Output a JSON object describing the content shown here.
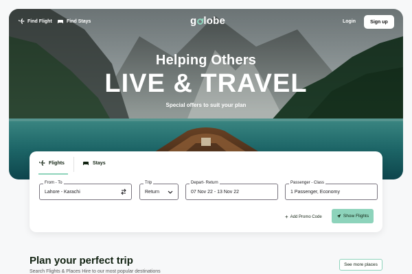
{
  "nav": {
    "find_flight": "Find Flight",
    "find_stays": "Find Stays",
    "logo_prefix": "g",
    "logo_suffix": "lobe",
    "login": "Login",
    "signup": "Sign up"
  },
  "hero": {
    "subtitle": "Helping Others",
    "title": "LIVE & TRAVEL",
    "tagline": "Special offers to suit your plan"
  },
  "search": {
    "tabs": [
      {
        "label": "Flights",
        "icon": "airplane-icon",
        "active": true
      },
      {
        "label": "Stays",
        "icon": "bed-icon",
        "active": false
      }
    ],
    "fields": {
      "from_to": {
        "label": "From - To",
        "value": "Lahore - Karachi",
        "icon": "swap-icon"
      },
      "trip": {
        "label": "Trip",
        "value": "Return",
        "icon": "chevron-down-icon"
      },
      "depart_return": {
        "label": "Depart- Return",
        "value": "07 Nov 22 - 13 Nov 22"
      },
      "passenger_class": {
        "label": "Passenger - Class",
        "value": "1 Passenger, Economy"
      }
    },
    "promo": "Add Promo Code",
    "promo_plus": "+",
    "show_button": "Show Flights"
  },
  "plan": {
    "title": "Plan your perfect trip",
    "subtitle": "Search Flights & Places Hire to our most popular destinations",
    "more_button": "See more places"
  },
  "colors": {
    "accent": "#8dd3bb",
    "dark_text": "#112211"
  }
}
